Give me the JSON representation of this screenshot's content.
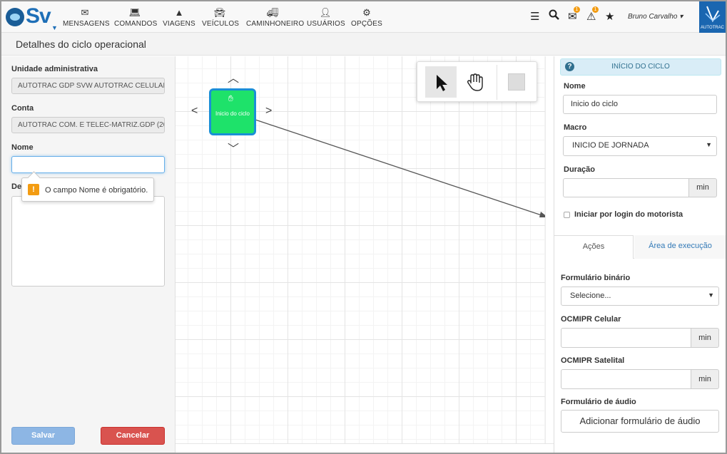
{
  "brand": {
    "logo_text": "Sv",
    "company": "AUTOTRAC",
    "accent": "#1e6fb7"
  },
  "nav": {
    "items": [
      {
        "label": "MENSAGENS",
        "icon": "envelope-icon"
      },
      {
        "label": "COMANDOS",
        "icon": "laptop-icon"
      },
      {
        "label": "VIAGENS",
        "icon": "road-icon"
      },
      {
        "label": "VEÍCULOS",
        "icon": "car-icon"
      },
      {
        "label": "CAMINHONEIRO",
        "icon": "truck-icon"
      },
      {
        "label": "USUÁRIOS",
        "icon": "user-icon"
      },
      {
        "label": "OPÇÕES",
        "icon": "cogs-icon"
      }
    ],
    "badges": {
      "messages": "1",
      "alerts": "1"
    },
    "user_name": "Bruno Carvalho"
  },
  "page": {
    "title": "Detalhes do ciclo operacional"
  },
  "left": {
    "unit_label": "Unidade administrativa",
    "unit_value": "AUTOTRAC GDP SVW AUTOTRAC CELULAI",
    "account_label": "Conta",
    "account_value": "AUTOTRAC COM. E TELEC-MATRIZ.GDP (20",
    "name_label": "Nome",
    "name_value": "",
    "description_label": "De",
    "tooltip_message": "O campo Nome é obrigatório.",
    "save_label": "Salvar",
    "cancel_label": "Cancelar"
  },
  "canvas": {
    "node_label": "Inicio do ciclo",
    "node_color": "#1ee26a",
    "tools": [
      "pointer-icon",
      "hand-icon",
      "square-icon"
    ]
  },
  "right": {
    "header": "INÍCIO DO CICLO",
    "name_label": "Nome",
    "name_value": "Inicio do ciclo",
    "macro_label": "Macro",
    "macro_value": "INICIO DE JORNADA",
    "duration_label": "Duração",
    "duration_value": "",
    "unit_min": "min",
    "login_label": "Iniciar por login do motorista",
    "tab_actions": "Ações",
    "tab_area": "Área de execução",
    "binary_form_label": "Formulário binário",
    "binary_form_value": "Selecione...",
    "ocmipr_cell_label": "OCMIPR Celular",
    "ocmipr_sat_label": "OCMIPR Satelital",
    "audio_form_label": "Formulário de áudio",
    "audio_form_button": "Adicionar formulário de áudio"
  }
}
